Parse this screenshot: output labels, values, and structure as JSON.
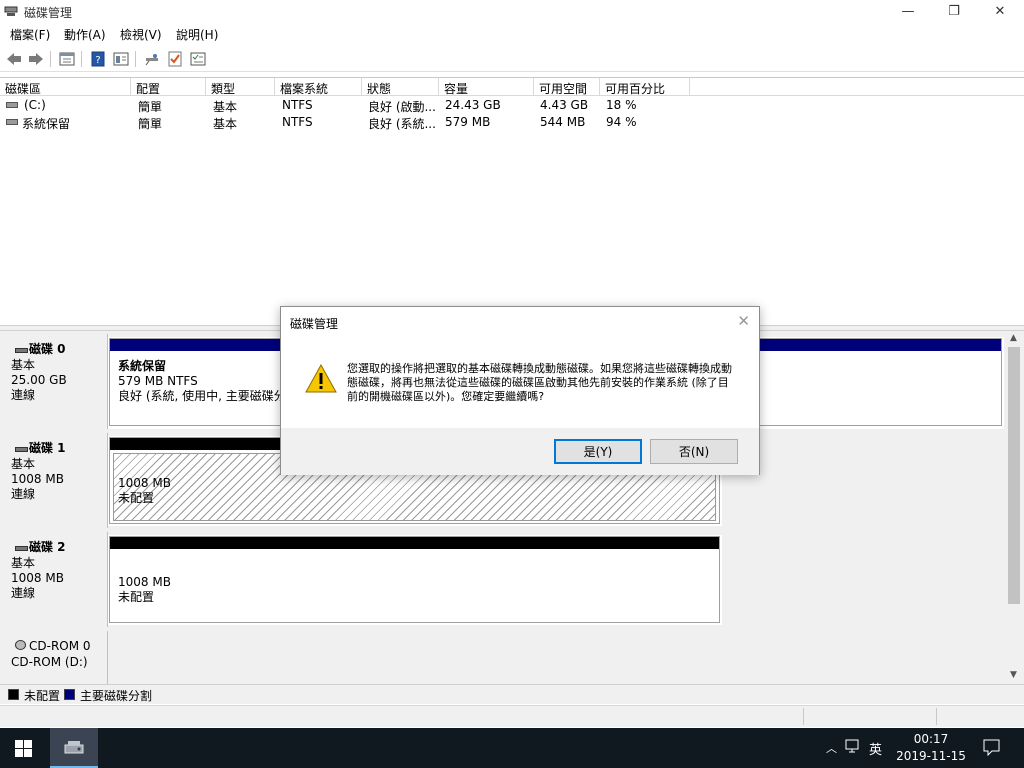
{
  "window": {
    "title": "磁碟管理",
    "controls": {
      "minimize": "—",
      "restore": "❐",
      "close": "✕"
    }
  },
  "menu": [
    {
      "label": "檔案(F)"
    },
    {
      "label": "動作(A)"
    },
    {
      "label": "檢視(V)"
    },
    {
      "label": "說明(H)"
    }
  ],
  "toolbar": {
    "icons": [
      "back-arrow-icon",
      "forward-arrow-icon",
      "properties-icon",
      "help-icon",
      "refresh-icon",
      "map-icon",
      "check-icon",
      "settings-icon"
    ]
  },
  "volume_list": {
    "columns": [
      "磁碟區",
      "配置",
      "類型",
      "檔案系統",
      "狀態",
      "容量",
      "可用空間",
      "可用百分比"
    ],
    "rows": [
      {
        "name": "(C:)",
        "layout": "簡單",
        "type": "基本",
        "fs": "NTFS",
        "status": "良好 (啟動...",
        "capacity": "24.43 GB",
        "free": "4.43 GB",
        "pct": "18 %"
      },
      {
        "name": "系統保留",
        "layout": "簡單",
        "type": "基本",
        "fs": "NTFS",
        "status": "良好 (系統...",
        "capacity": "579 MB",
        "free": "544 MB",
        "pct": "94 %"
      }
    ]
  },
  "disks": [
    {
      "name": "磁碟 0",
      "type": "基本",
      "size": "25.00 GB",
      "state": "連線",
      "partition": {
        "title": "系統保留",
        "line1": "579 MB NTFS",
        "line2": "良好 (系統, 使用中, 主要磁碟分"
      }
    },
    {
      "name": "磁碟 1",
      "type": "基本",
      "size": "1008 MB",
      "state": "連線",
      "partition": {
        "line1": "1008 MB",
        "line2": "未配置"
      }
    },
    {
      "name": "磁碟 2",
      "type": "基本",
      "size": "1008 MB",
      "state": "連線",
      "partition": {
        "line1": "1008 MB",
        "line2": "未配置"
      }
    },
    {
      "name": "CD-ROM 0",
      "type": "CD-ROM (D:)"
    }
  ],
  "legend": [
    {
      "label": "未配置",
      "color": "#000000"
    },
    {
      "label": "主要磁碟分割",
      "color": "#00007b"
    }
  ],
  "dialog": {
    "title": "磁碟管理",
    "message": "您選取的操作將把選取的基本磁碟轉換成動態磁碟。如果您將這些磁碟轉換成動態磁碟，將再也無法從這些磁碟的磁碟區啟動其他先前安裝的作業系統 (除了目前的開機磁碟區以外)。您確定要繼續嗎?",
    "yes": "是(Y)",
    "no": "否(N)"
  },
  "taskbar": {
    "ime": "英",
    "time": "00:17",
    "date": "2019-11-15"
  },
  "colors": {
    "primary_partition": "#00007b",
    "unallocated": "#000000",
    "accent": "#0078d7"
  }
}
